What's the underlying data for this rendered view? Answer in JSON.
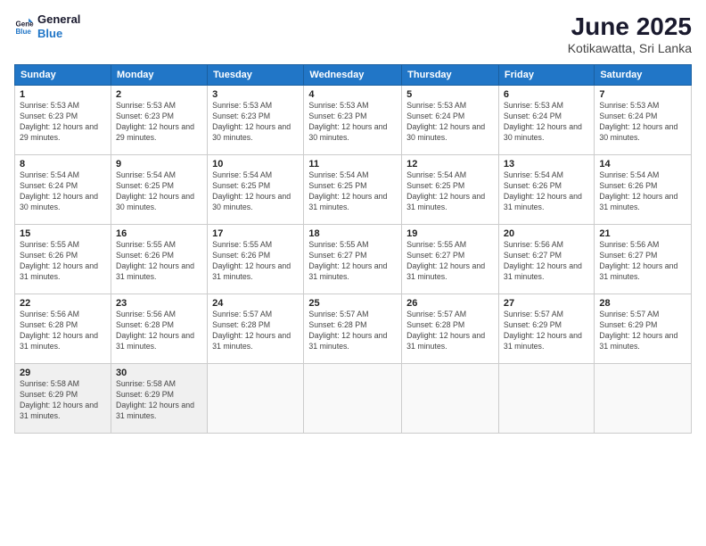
{
  "logo": {
    "line1": "General",
    "line2": "Blue"
  },
  "title": "June 2025",
  "subtitle": "Kotikawatta, Sri Lanka",
  "weekdays": [
    "Sunday",
    "Monday",
    "Tuesday",
    "Wednesday",
    "Thursday",
    "Friday",
    "Saturday"
  ],
  "weeks": [
    [
      {
        "day": "1",
        "sunrise": "Sunrise: 5:53 AM",
        "sunset": "Sunset: 6:23 PM",
        "daylight": "Daylight: 12 hours and 29 minutes."
      },
      {
        "day": "2",
        "sunrise": "Sunrise: 5:53 AM",
        "sunset": "Sunset: 6:23 PM",
        "daylight": "Daylight: 12 hours and 29 minutes."
      },
      {
        "day": "3",
        "sunrise": "Sunrise: 5:53 AM",
        "sunset": "Sunset: 6:23 PM",
        "daylight": "Daylight: 12 hours and 30 minutes."
      },
      {
        "day": "4",
        "sunrise": "Sunrise: 5:53 AM",
        "sunset": "Sunset: 6:23 PM",
        "daylight": "Daylight: 12 hours and 30 minutes."
      },
      {
        "day": "5",
        "sunrise": "Sunrise: 5:53 AM",
        "sunset": "Sunset: 6:24 PM",
        "daylight": "Daylight: 12 hours and 30 minutes."
      },
      {
        "day": "6",
        "sunrise": "Sunrise: 5:53 AM",
        "sunset": "Sunset: 6:24 PM",
        "daylight": "Daylight: 12 hours and 30 minutes."
      },
      {
        "day": "7",
        "sunrise": "Sunrise: 5:53 AM",
        "sunset": "Sunset: 6:24 PM",
        "daylight": "Daylight: 12 hours and 30 minutes."
      }
    ],
    [
      {
        "day": "8",
        "sunrise": "Sunrise: 5:54 AM",
        "sunset": "Sunset: 6:24 PM",
        "daylight": "Daylight: 12 hours and 30 minutes."
      },
      {
        "day": "9",
        "sunrise": "Sunrise: 5:54 AM",
        "sunset": "Sunset: 6:25 PM",
        "daylight": "Daylight: 12 hours and 30 minutes."
      },
      {
        "day": "10",
        "sunrise": "Sunrise: 5:54 AM",
        "sunset": "Sunset: 6:25 PM",
        "daylight": "Daylight: 12 hours and 30 minutes."
      },
      {
        "day": "11",
        "sunrise": "Sunrise: 5:54 AM",
        "sunset": "Sunset: 6:25 PM",
        "daylight": "Daylight: 12 hours and 31 minutes."
      },
      {
        "day": "12",
        "sunrise": "Sunrise: 5:54 AM",
        "sunset": "Sunset: 6:25 PM",
        "daylight": "Daylight: 12 hours and 31 minutes."
      },
      {
        "day": "13",
        "sunrise": "Sunrise: 5:54 AM",
        "sunset": "Sunset: 6:26 PM",
        "daylight": "Daylight: 12 hours and 31 minutes."
      },
      {
        "day": "14",
        "sunrise": "Sunrise: 5:54 AM",
        "sunset": "Sunset: 6:26 PM",
        "daylight": "Daylight: 12 hours and 31 minutes."
      }
    ],
    [
      {
        "day": "15",
        "sunrise": "Sunrise: 5:55 AM",
        "sunset": "Sunset: 6:26 PM",
        "daylight": "Daylight: 12 hours and 31 minutes."
      },
      {
        "day": "16",
        "sunrise": "Sunrise: 5:55 AM",
        "sunset": "Sunset: 6:26 PM",
        "daylight": "Daylight: 12 hours and 31 minutes."
      },
      {
        "day": "17",
        "sunrise": "Sunrise: 5:55 AM",
        "sunset": "Sunset: 6:26 PM",
        "daylight": "Daylight: 12 hours and 31 minutes."
      },
      {
        "day": "18",
        "sunrise": "Sunrise: 5:55 AM",
        "sunset": "Sunset: 6:27 PM",
        "daylight": "Daylight: 12 hours and 31 minutes."
      },
      {
        "day": "19",
        "sunrise": "Sunrise: 5:55 AM",
        "sunset": "Sunset: 6:27 PM",
        "daylight": "Daylight: 12 hours and 31 minutes."
      },
      {
        "day": "20",
        "sunrise": "Sunrise: 5:56 AM",
        "sunset": "Sunset: 6:27 PM",
        "daylight": "Daylight: 12 hours and 31 minutes."
      },
      {
        "day": "21",
        "sunrise": "Sunrise: 5:56 AM",
        "sunset": "Sunset: 6:27 PM",
        "daylight": "Daylight: 12 hours and 31 minutes."
      }
    ],
    [
      {
        "day": "22",
        "sunrise": "Sunrise: 5:56 AM",
        "sunset": "Sunset: 6:28 PM",
        "daylight": "Daylight: 12 hours and 31 minutes."
      },
      {
        "day": "23",
        "sunrise": "Sunrise: 5:56 AM",
        "sunset": "Sunset: 6:28 PM",
        "daylight": "Daylight: 12 hours and 31 minutes."
      },
      {
        "day": "24",
        "sunrise": "Sunrise: 5:57 AM",
        "sunset": "Sunset: 6:28 PM",
        "daylight": "Daylight: 12 hours and 31 minutes."
      },
      {
        "day": "25",
        "sunrise": "Sunrise: 5:57 AM",
        "sunset": "Sunset: 6:28 PM",
        "daylight": "Daylight: 12 hours and 31 minutes."
      },
      {
        "day": "26",
        "sunrise": "Sunrise: 5:57 AM",
        "sunset": "Sunset: 6:28 PM",
        "daylight": "Daylight: 12 hours and 31 minutes."
      },
      {
        "day": "27",
        "sunrise": "Sunrise: 5:57 AM",
        "sunset": "Sunset: 6:29 PM",
        "daylight": "Daylight: 12 hours and 31 minutes."
      },
      {
        "day": "28",
        "sunrise": "Sunrise: 5:57 AM",
        "sunset": "Sunset: 6:29 PM",
        "daylight": "Daylight: 12 hours and 31 minutes."
      }
    ],
    [
      {
        "day": "29",
        "sunrise": "Sunrise: 5:58 AM",
        "sunset": "Sunset: 6:29 PM",
        "daylight": "Daylight: 12 hours and 31 minutes."
      },
      {
        "day": "30",
        "sunrise": "Sunrise: 5:58 AM",
        "sunset": "Sunset: 6:29 PM",
        "daylight": "Daylight: 12 hours and 31 minutes."
      },
      {
        "day": "",
        "sunrise": "",
        "sunset": "",
        "daylight": ""
      },
      {
        "day": "",
        "sunrise": "",
        "sunset": "",
        "daylight": ""
      },
      {
        "day": "",
        "sunrise": "",
        "sunset": "",
        "daylight": ""
      },
      {
        "day": "",
        "sunrise": "",
        "sunset": "",
        "daylight": ""
      },
      {
        "day": "",
        "sunrise": "",
        "sunset": "",
        "daylight": ""
      }
    ]
  ]
}
